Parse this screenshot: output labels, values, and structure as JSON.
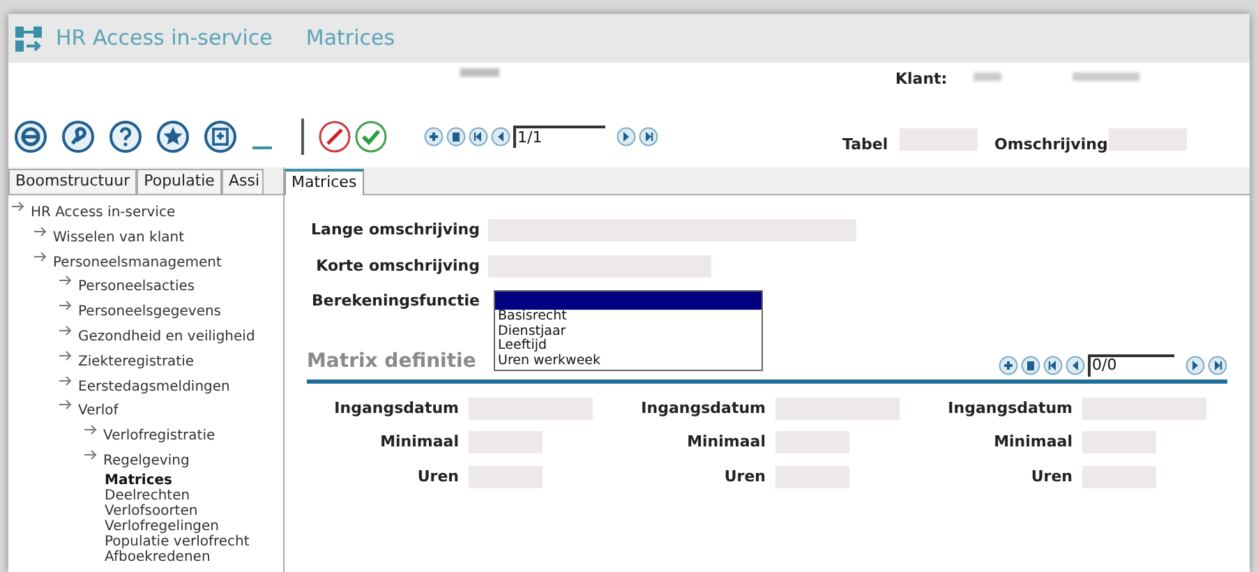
{
  "window": {
    "app_title": "HR Access in-service",
    "page_title": "Matrices"
  },
  "header": {
    "client_label": "Klant:",
    "tabel_label": "Tabel",
    "omschrijving_label": "Omschrijving"
  },
  "toolbar": {
    "pager_value": "1/1"
  },
  "tabs": [
    {
      "label": "Boomstructuur",
      "selected": false
    },
    {
      "label": "Populatie",
      "selected": false
    },
    {
      "label": "Assi",
      "selected": false
    },
    {
      "label": "Matrices",
      "selected": true
    }
  ],
  "tree": [
    {
      "label": "HR Access in-service",
      "kind": "folder",
      "selected": false,
      "children": [
        {
          "label": "Wisselen van klant",
          "kind": "folder",
          "selected": false
        },
        {
          "label": "Personeelsmanagement",
          "kind": "folder",
          "selected": false,
          "children": [
            {
              "label": "Personeelsacties",
              "kind": "folder",
              "selected": false
            },
            {
              "label": "Personeelsgegevens",
              "kind": "folder",
              "selected": false
            },
            {
              "label": "Gezondheid en veiligheid",
              "kind": "folder",
              "selected": false
            },
            {
              "label": "Ziekteregistratie",
              "kind": "folder",
              "selected": false
            },
            {
              "label": "Eerstedagsmeldingen",
              "kind": "folder",
              "selected": false
            },
            {
              "label": "Verlof",
              "kind": "folder",
              "selected": false,
              "children": [
                {
                  "label": "Verlofregistratie",
                  "kind": "folder",
                  "selected": false
                },
                {
                  "label": "Regelgeving",
                  "kind": "folder",
                  "selected": false,
                  "children": [
                    {
                      "label": "Matrices",
                      "kind": "page",
                      "selected": true
                    },
                    {
                      "label": "Deelrechten",
                      "kind": "page",
                      "selected": false
                    },
                    {
                      "label": "Verlofsoorten",
                      "kind": "page",
                      "selected": false
                    },
                    {
                      "label": "Verlofregelingen",
                      "kind": "page",
                      "selected": false
                    },
                    {
                      "label": "Populatie verlofrecht",
                      "kind": "page",
                      "selected": false
                    },
                    {
                      "label": "Afboekredenen",
                      "kind": "page",
                      "selected": false
                    }
                  ]
                }
              ]
            }
          ]
        }
      ]
    }
  ],
  "form": {
    "lange_label": "Lange omschrijving",
    "korte_label": "Korte omschrijving",
    "functie_label": "Berekeningsfunctie",
    "dropdown": {
      "blank_option_highlighted": true,
      "options": [
        {
          "label": "Basisrecht",
          "selected": false
        },
        {
          "label": "Dienstjaar",
          "selected": false
        },
        {
          "label": "Leeftijd",
          "selected": false
        },
        {
          "label": "Uren werkweek",
          "selected": false
        }
      ]
    }
  },
  "matrix": {
    "title": "Matrix definitie",
    "pager_value": "0/0",
    "columns": [
      {
        "ingangsdatum_label": "Ingangsdatum",
        "minimaal_label": "Minimaal",
        "uren_label": "Uren"
      },
      {
        "ingangsdatum_label": "Ingangsdatum",
        "minimaal_label": "Minimaal",
        "uren_label": "Uren"
      },
      {
        "ingangsdatum_label": "Ingangsdatum",
        "minimaal_label": "Minimaal",
        "uren_label": "Uren"
      }
    ]
  }
}
